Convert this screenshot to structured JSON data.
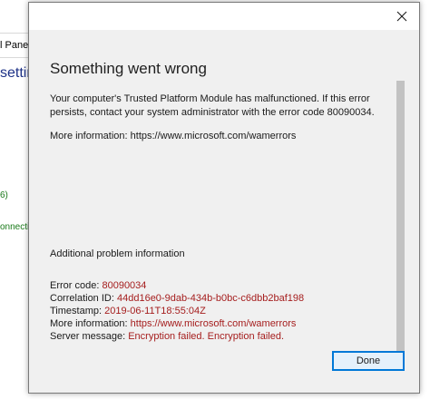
{
  "background": {
    "address_text": "l Panel",
    "heading_text": "setting",
    "green_text_1": "6)",
    "green_text_2": "onnectio"
  },
  "dialog": {
    "title": "Something went wrong",
    "message": "Your computer's Trusted Platform Module has malfunctioned. If this error persists, contact your system administrator with the error code 80090034.",
    "more_info": "More information: https://www.microsoft.com/wamerrors",
    "additional_heading": "Additional problem information",
    "details": [
      {
        "label": "Error code: ",
        "value": "80090034"
      },
      {
        "label": "Correlation ID: ",
        "value": "44dd16e0-9dab-434b-b0bc-c6dbb2baf198"
      },
      {
        "label": "Timestamp: ",
        "value": "2019-06-11T18:55:04Z"
      },
      {
        "label": "More information: ",
        "value": "https://www.microsoft.com/wamerrors"
      },
      {
        "label": "Server message: ",
        "value": "Encryption failed. Encryption failed."
      }
    ],
    "done_label": "Done",
    "close_icon": "close-icon"
  },
  "colors": {
    "detail_value": "#a51d1d",
    "button_border": "#0078d7",
    "dialog_bg": "#f0f0f0"
  }
}
